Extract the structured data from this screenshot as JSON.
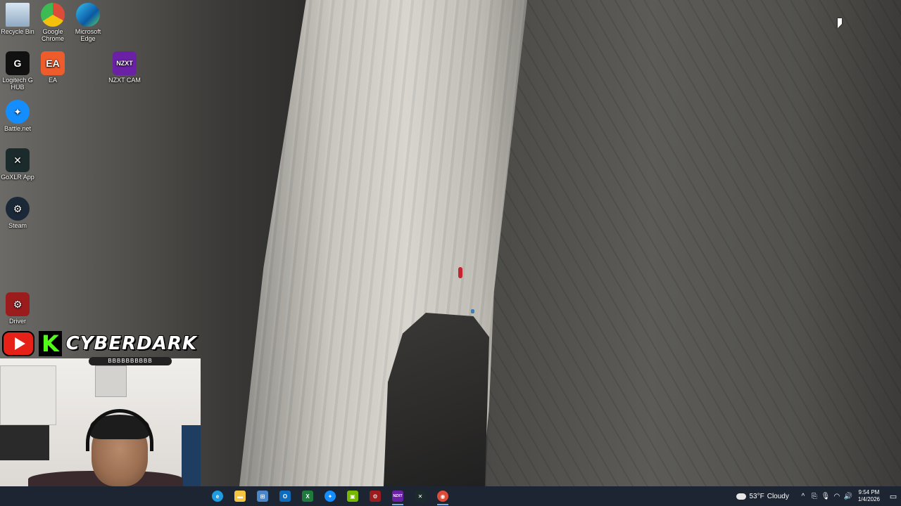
{
  "desktop": {
    "icons": [
      {
        "label": "Recycle Bin",
        "icon": "recycle-bin-icon",
        "color": "#9fb8d0"
      },
      {
        "label": "Google Chrome",
        "icon": "chrome-icon",
        "color": "#dd4b39"
      },
      {
        "label": "Microsoft Edge",
        "icon": "edge-icon",
        "color": "#1f9be0"
      },
      {
        "label": "Logitech G HUB",
        "icon": "logitech-ghub-icon",
        "color": "#111111",
        "glyph": "G"
      },
      {
        "label": "EA",
        "icon": "ea-icon",
        "color": "#ef5c2b",
        "glyph": "EA"
      },
      {
        "label": "NZXT CAM",
        "icon": "nzxt-cam-icon",
        "color": "#6a21a6",
        "glyph": "NZXT"
      },
      {
        "label": "Battle.net",
        "icon": "battlenet-icon",
        "color": "#148eff",
        "glyph": "✦"
      },
      {
        "label": "GoXLR App",
        "icon": "goxlr-icon",
        "color": "#1b2a2a",
        "glyph": "✕"
      },
      {
        "label": "Steam",
        "icon": "steam-icon",
        "color": "#1b2838",
        "glyph": "⚙"
      },
      {
        "label": "Driver",
        "icon": "driver-icon",
        "color": "#9b1c1c",
        "glyph": "⚙"
      }
    ]
  },
  "overlay": {
    "brand_name": "CYBERDARK",
    "brand_sub": "BBBBBBBBBB",
    "youtube_icon": "youtube-icon",
    "kick_glyph": "K",
    "kick_color": "#53fc18",
    "youtube_color": "#e62117"
  },
  "taskbar": {
    "apps": [
      {
        "name": "edge",
        "icon": "edge-icon",
        "color": "#1f9be0",
        "glyph": "e",
        "running": false
      },
      {
        "name": "file-explorer",
        "icon": "folder-icon",
        "color": "#f4c542",
        "glyph": "▬",
        "running": false
      },
      {
        "name": "microsoft-store",
        "icon": "store-icon",
        "color": "#4a86c8",
        "glyph": "⊞",
        "running": false
      },
      {
        "name": "outlook",
        "icon": "outlook-icon",
        "color": "#0f6cbd",
        "glyph": "O",
        "running": false
      },
      {
        "name": "excel",
        "icon": "excel-icon",
        "color": "#1f7a3e",
        "glyph": "X",
        "running": false
      },
      {
        "name": "battlenet",
        "icon": "battlenet-icon",
        "color": "#148eff",
        "glyph": "✦",
        "running": false
      },
      {
        "name": "nvidia",
        "icon": "nvidia-icon",
        "color": "#76b900",
        "glyph": "▣",
        "running": false
      },
      {
        "name": "driver",
        "icon": "driver-icon",
        "color": "#9b1c1c",
        "glyph": "⚙",
        "running": false
      },
      {
        "name": "nzxt-cam",
        "icon": "nzxt-cam-icon",
        "color": "#6a21a6",
        "glyph": "NZXT",
        "running": true
      },
      {
        "name": "goxlr",
        "icon": "goxlr-icon",
        "color": "#1b2a2a",
        "glyph": "✕",
        "running": false
      },
      {
        "name": "chrome",
        "icon": "chrome-icon",
        "color": "#dd4b39",
        "glyph": "◉",
        "running": true
      }
    ],
    "weather": {
      "temp": "53°F",
      "condition": "Cloudy"
    },
    "tray_icons": [
      "chevron-up-icon",
      "network-icon",
      "microphone-icon",
      "wifi-icon",
      "volume-icon"
    ],
    "tray_glyphs": [
      "^",
      "⎘",
      "🎙",
      "◠",
      "🔊"
    ],
    "time": "9:54 PM",
    "date": "1/4/2026",
    "notification_icon": "notification-icon"
  },
  "colors": {
    "taskbar_bg": "#1c2531",
    "accent": "#7aa7d8"
  }
}
